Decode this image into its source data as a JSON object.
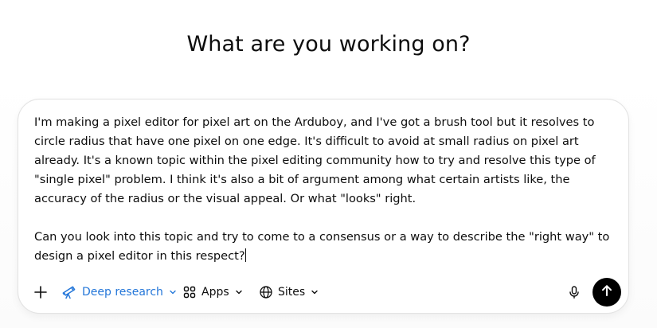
{
  "heading": "What are you working on?",
  "prompt": {
    "text": "I'm making a pixel editor for pixel art on the Arduboy, and I've got a brush tool but it resolves to circle radius that have one pixel on one edge. It's difficult to avoid at small radius on pixel art already. It's a known topic within the pixel editing community how to try and resolve this type of \"single pixel\" problem. I think it's also a bit of argument among what certain artists like, the accuracy of the radius or the visual appeal. Or what \"looks\" right.\n\nCan you look into this topic and try to come to a consensus or a way to describe the \"right way\" to design a pixel editor in this respect?"
  },
  "toolbar": {
    "add_icon": "plus-icon",
    "deep_research": {
      "label": "Deep research",
      "icon": "telescope-icon",
      "color": "#2577d9"
    },
    "apps": {
      "label": "Apps",
      "icon": "apps-grid-icon"
    },
    "sites": {
      "label": "Sites",
      "icon": "globe-icon"
    },
    "mic_icon": "microphone-icon",
    "send_icon": "arrow-up-icon"
  }
}
